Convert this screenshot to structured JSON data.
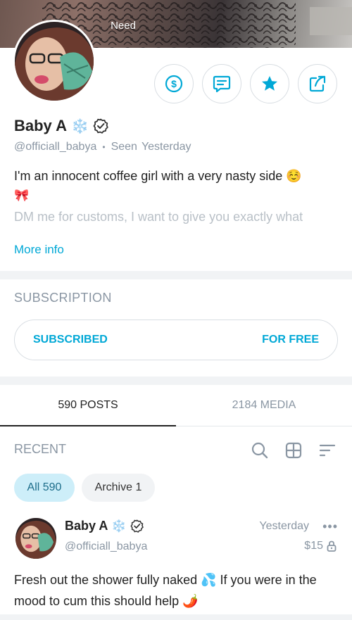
{
  "cover": {
    "label": "Need"
  },
  "profile": {
    "name": "Baby A",
    "name_emoji": "❄️",
    "handle": "@officiall_babya",
    "seen_label": "Seen",
    "seen_value": "Yesterday",
    "bio_line1": "I'm an innocent coffee girl with a very nasty side ☺️",
    "bio_line2": "🎀",
    "bio_line3": "DM me for customs, I want to give you exactly what",
    "more_info": "More info"
  },
  "actions": {
    "tip_icon": "dollar-circle-icon",
    "message_icon": "message-icon",
    "favorite_icon": "star-icon",
    "share_icon": "share-icon"
  },
  "subscription": {
    "title": "SUBSCRIPTION",
    "status": "SUBSCRIBED",
    "price": "FOR FREE"
  },
  "tabs": [
    {
      "label": "590 POSTS",
      "active": true
    },
    {
      "label": "2184 MEDIA",
      "active": false
    }
  ],
  "feed": {
    "section_title": "RECENT",
    "filters": [
      {
        "label": "All 590",
        "active": true
      },
      {
        "label": "Archive 1",
        "active": false
      }
    ]
  },
  "post": {
    "author_name": "Baby A",
    "author_emoji": "❄️",
    "author_handle": "@officiall_babya",
    "time": "Yesterday",
    "more": "•••",
    "price": "$15",
    "text": "Fresh out the shower fully naked 💦 If you were in the mood to cum this should help 🌶️"
  },
  "colors": {
    "accent": "#00a8d6",
    "muted": "#8a96a3",
    "chip_active_bg": "#cdeef9",
    "divider": "#f1f3f5"
  }
}
